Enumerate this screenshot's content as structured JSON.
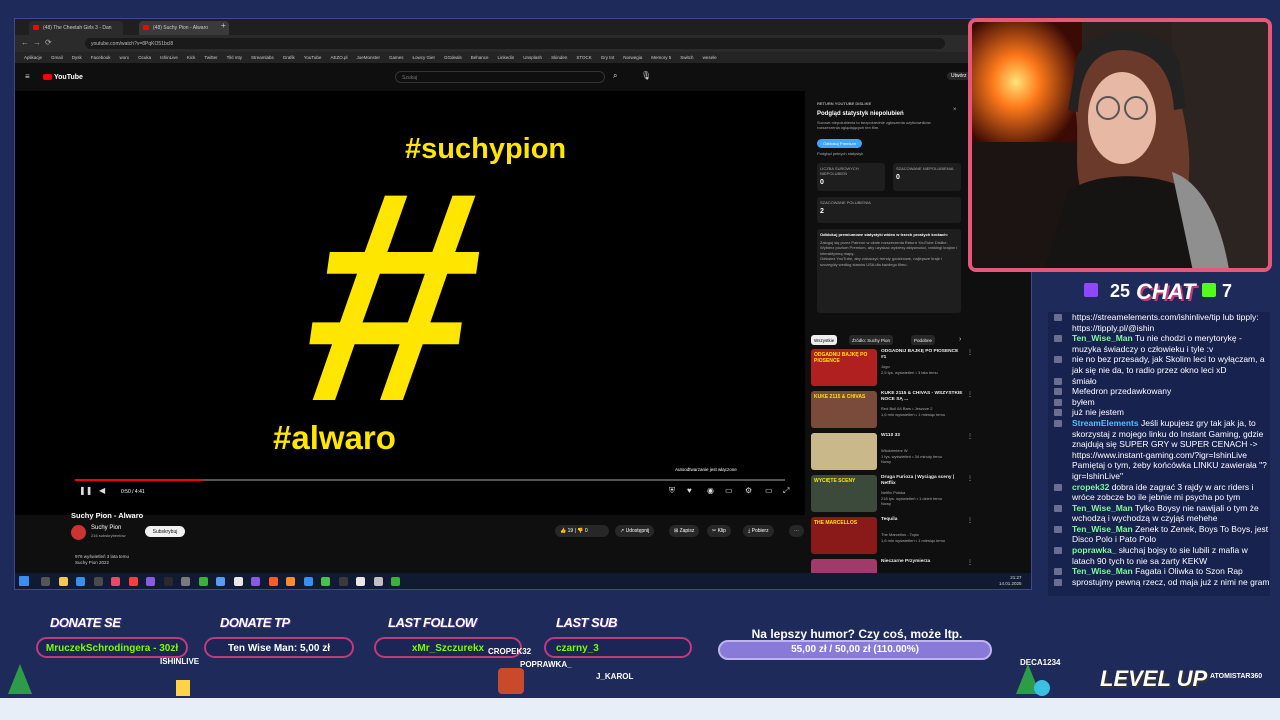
{
  "browser": {
    "tabs": [
      "(48) The Cheetah Girls 3 - Dan",
      "(48) Suchy Pion - Alwaro"
    ],
    "url": "youtube.com/watch?v=8PqKO51bcl8",
    "bookmarks": [
      "Aplikacje",
      "Gmail",
      "Dysk",
      "Facebook",
      "worx",
      "Ocuka",
      "IshinLive",
      "Kick",
      "Twitter",
      "Tikl mty",
      "Streamlabs",
      "Grafik",
      "YouTube",
      "AEZO.pl",
      "JoeMonster",
      "Games",
      "Łowcy Gier",
      "GGdeals",
      "Behance",
      "Linkedin",
      "Unsplash",
      "Skinden",
      "STOCK",
      "Gry tnt",
      "Norwegia",
      "Memory 5",
      "Switch",
      "wesele"
    ]
  },
  "youtube": {
    "logo": "YouTube",
    "search_placeholder": "Szukaj",
    "create_label": "Utwórz",
    "video": {
      "line1": "#suchypion",
      "hash": "#",
      "line2": "#alwaro",
      "time": "0:50 / 4:41",
      "autoplay": "Autoodtwarzanie jest włączone",
      "progress": 0.18,
      "title": "Suchy Pion - Alwaro",
      "channel": "Suchy Pion",
      "subscribers": "216 subskrybentów",
      "subscribe": "Subskrybuj",
      "likes": "19",
      "dislikes": "0",
      "share": "Udostępnij",
      "save": "Zapisz",
      "clip": "Klip",
      "download": "Pobierz",
      "views": "976 wyświetleń  3 lata temu",
      "desc": "Suchy Pion 2022"
    },
    "ryd": {
      "badge": "RETURN YOUTUBE DISLIKE",
      "heading": "Podgląd statystyk niepolubień",
      "text": "Surowe niepolubienia to bezpośrednie zgłoszenia użytkowników rozszerzenia oglądających ten film.",
      "btn": "Odblokuj Premium",
      "sub": "Podgląd pełnych statystyk",
      "raw_label": "LICZBA SUROWYCH NIEPOLUBIEŃ",
      "raw_val": "0",
      "est_label": "SZACOWANE NIEPOLUBIENIA",
      "est_val": "0",
      "likes_label": "SZACOWANE POLUBIENIA",
      "likes_val": "2",
      "promo_title": "Odblokuj premiumowe statystyki wideo w trzech prostych krokach:",
      "steps": [
        "Zaloguj się przez Patreon w oknie rozszerzenia Return YouTube Dislike.",
        "Wybierz poziom Premium, aby uzyskać wykresy aktywności, rankingi krajów i interaktywną mapę.",
        "Odśwież YouTube, aby zobaczyć trendy godzinowe, najlepsze kraje i szczegóły według stanów USA dla każdego filmu."
      ]
    },
    "chips": [
      "Wszystkie",
      "Źródło: Suchy Pion",
      "Podobne"
    ],
    "recs": [
      {
        "title": "ODGADNIJ BAJKĘ PO PIOSENCE #1",
        "meta": "Jogo\n2,5 tys. wyświetleń • 3 lata temu",
        "thumb": "#b02020",
        "thumb_text": "ODGADNIJ BAJKĘ PO PIOSENCE"
      },
      {
        "title": "KUKE 2115 & CHIVAS - WSZYSTKIE NOCE SĄ ...",
        "meta": "Red Bull 64 Bars • Jeszcze 2\n1,6 mln wyświetleń • 1 miesiąc temu",
        "thumb": "#7a4a3a",
        "thumb_text": "KUKE 2115 & CHIVAS"
      },
      {
        "title": "W110 33",
        "meta": "Włodzimierz W\n1 tys. wyświetleń • 34 minuty temu\nNowy",
        "thumb": "#c9b98a",
        "thumb_text": ""
      },
      {
        "title": "Druga Furioza | Wyciąga sceny | Netflix",
        "meta": "Netflix Polska\n218 tys. wyświetleń • 1 dzień temu\nNowy",
        "thumb": "#3b4a3a",
        "thumb_text": "WYCIĘTE SCENY"
      },
      {
        "title": "Tequila",
        "meta": "The Marcellos - Topic\n1,6 mln wyświetleń • 1 miesiąc temu",
        "thumb": "#8a1a1a",
        "thumb_text": "THE MARCELLOS"
      },
      {
        "title": "Nieczarne Przymierza",
        "meta": "",
        "thumb": "#a03a6a",
        "thumb_text": ""
      }
    ]
  },
  "taskbar": {
    "clock": "21:27",
    "date": "14.01.2025"
  },
  "overlay": {
    "twitch_count": "25",
    "kick_count": "7",
    "chat_title": "CHAT",
    "chat": [
      {
        "name": "",
        "text": "https://streamelements.com/ishinlive/tip lub tipply: https://tipply.pl/@ishin"
      },
      {
        "name": "Ten_Wise_Man",
        "text": " Tu nie chodzi o merytorykę - muzyka świadczy o człowieku i tyle :v"
      },
      {
        "name": "",
        "text": "nie no bez przesady, jak Skolim leci to wyłączam, a jak się nie da, to radio przez okno leci xD"
      },
      {
        "name": "",
        "text": "śmiało"
      },
      {
        "name": "",
        "text": "Mefedron przedawkowany"
      },
      {
        "name": "",
        "text": "byłem"
      },
      {
        "name": "",
        "text": "już nie jestem"
      },
      {
        "name": "StreamElements",
        "text": " Jeśli kupujesz gry tak jak ja, to skorzystaj z mojego linku do Instant Gaming, gdzie znajdują się SUPER GRY w SUPER CENACH -> https://www.instant-gaming.com/?igr=IshinLive Pamiętaj o tym, żeby końcówka LINKU zawierała \"?igr=IshinLive\""
      },
      {
        "name": "cropek32",
        "text": " dobra ide zagrać 3 rajdy w arc riders i wróce zobcze bo ile jebnie mi psycha po tym"
      },
      {
        "name": "Ten_Wise_Man",
        "text": " Tylko Boysy nie nawijali o tym że wchodzą i wychodzą w czyjąś mehehe"
      },
      {
        "name": "Ten_Wise_Man",
        "text": " Zenek to Zenek, Boys To Boys, jest Disco Polo i Pato Polo"
      },
      {
        "name": "poprawka_",
        "text": " słuchaj bojsy to sie lubili z mafia w latach 90 tych to nie sa zarty KEKW"
      },
      {
        "name": "Ten_Wise_Man",
        "text": " Fagata i Oliwka to Szon Rap"
      },
      {
        "name": "",
        "text": "sprostujmy pewną rzecz, od maja już z nimi ne gram"
      }
    ],
    "donate_se_label": "DONATE SE",
    "donate_se": "MruczekSchrodingera - 30zł",
    "donate_tp_label": "DONATE TP",
    "donate_tp": "Ten Wise Man: 5,00 zł",
    "last_follow_label": "LAST FOLLOW",
    "last_follow": "xMr_Szczurekx",
    "last_sub_label": "LAST SUB",
    "last_sub": "czarny_3",
    "goal_title": "Na lepszy humor? Czy coś, może ltp.",
    "goal_progress": "55,00 zł / 50,00 zł (110.00%)",
    "names": [
      "ISHINLIVE",
      "CROPEK32",
      "POPRAWKA_",
      "DECA1234",
      "J_KAROL"
    ],
    "level_up": "LEVEL UP",
    "corner_tag": "ATOMISTAR360"
  }
}
